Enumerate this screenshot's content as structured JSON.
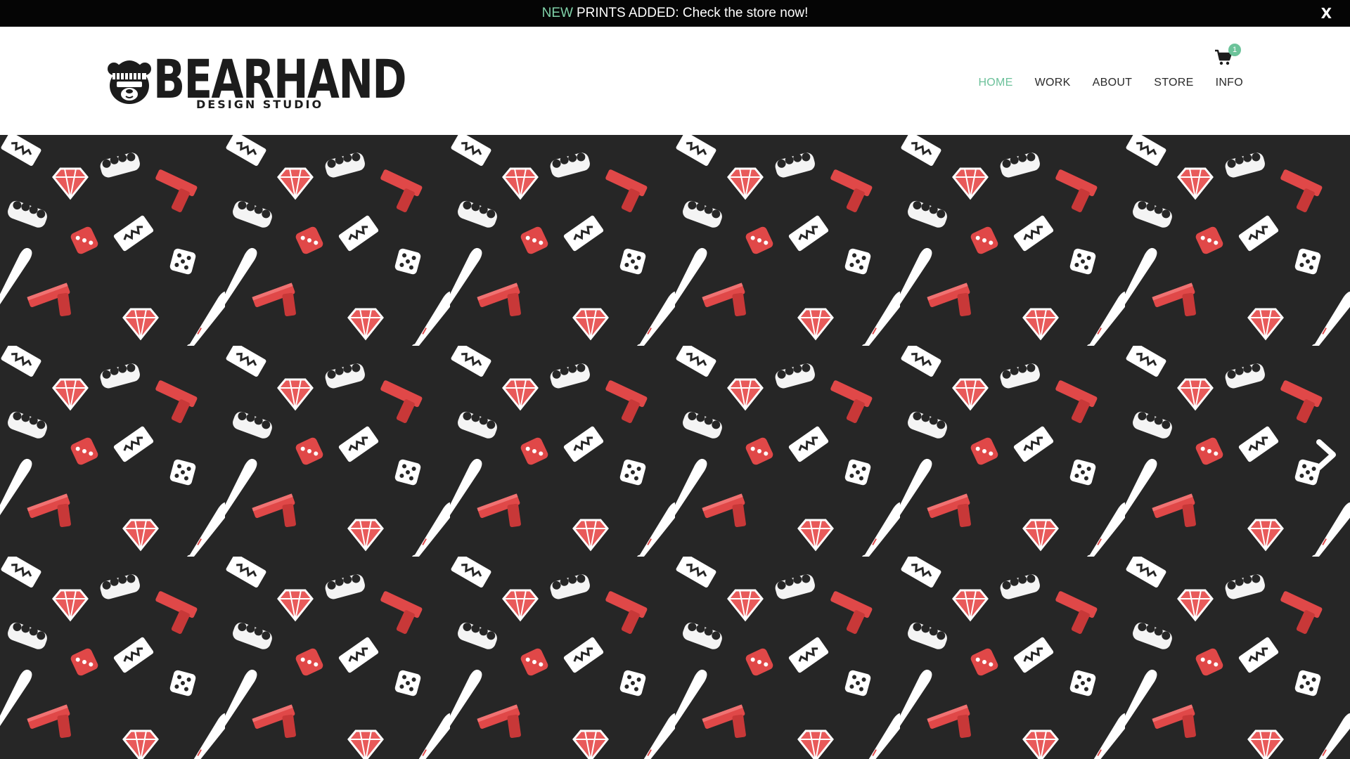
{
  "announcement": {
    "highlight": "NEW",
    "message": "PRINTS ADDED: Check the store now!",
    "close_label": "X",
    "highlight_color": "#7fd1a8"
  },
  "logo": {
    "wordmark": "BEARHAND",
    "subtitle": "DESIGN STUDIO",
    "icon": "bear-beanie-mascot-icon"
  },
  "cart": {
    "count": "1",
    "icon": "shopping-cart-icon",
    "badge_color": "#6cc39a"
  },
  "nav": {
    "items": [
      {
        "label": "HOME",
        "active": true
      },
      {
        "label": "WORK",
        "active": false
      },
      {
        "label": "ABOUT",
        "active": false
      },
      {
        "label": "STORE",
        "active": false
      },
      {
        "label": "INFO",
        "active": false
      }
    ],
    "active_color": "#6cc19a"
  },
  "hero": {
    "pattern_icons": [
      "pistol-icon",
      "brass-knuckles-icon",
      "dice-icon",
      "diamond-icon",
      "razor-blade-icon",
      "baseball-bat-icon"
    ],
    "next_icon": "chevron-right-icon",
    "colors": {
      "background": "#262626",
      "red": "#e04848",
      "white": "#ffffff"
    }
  }
}
